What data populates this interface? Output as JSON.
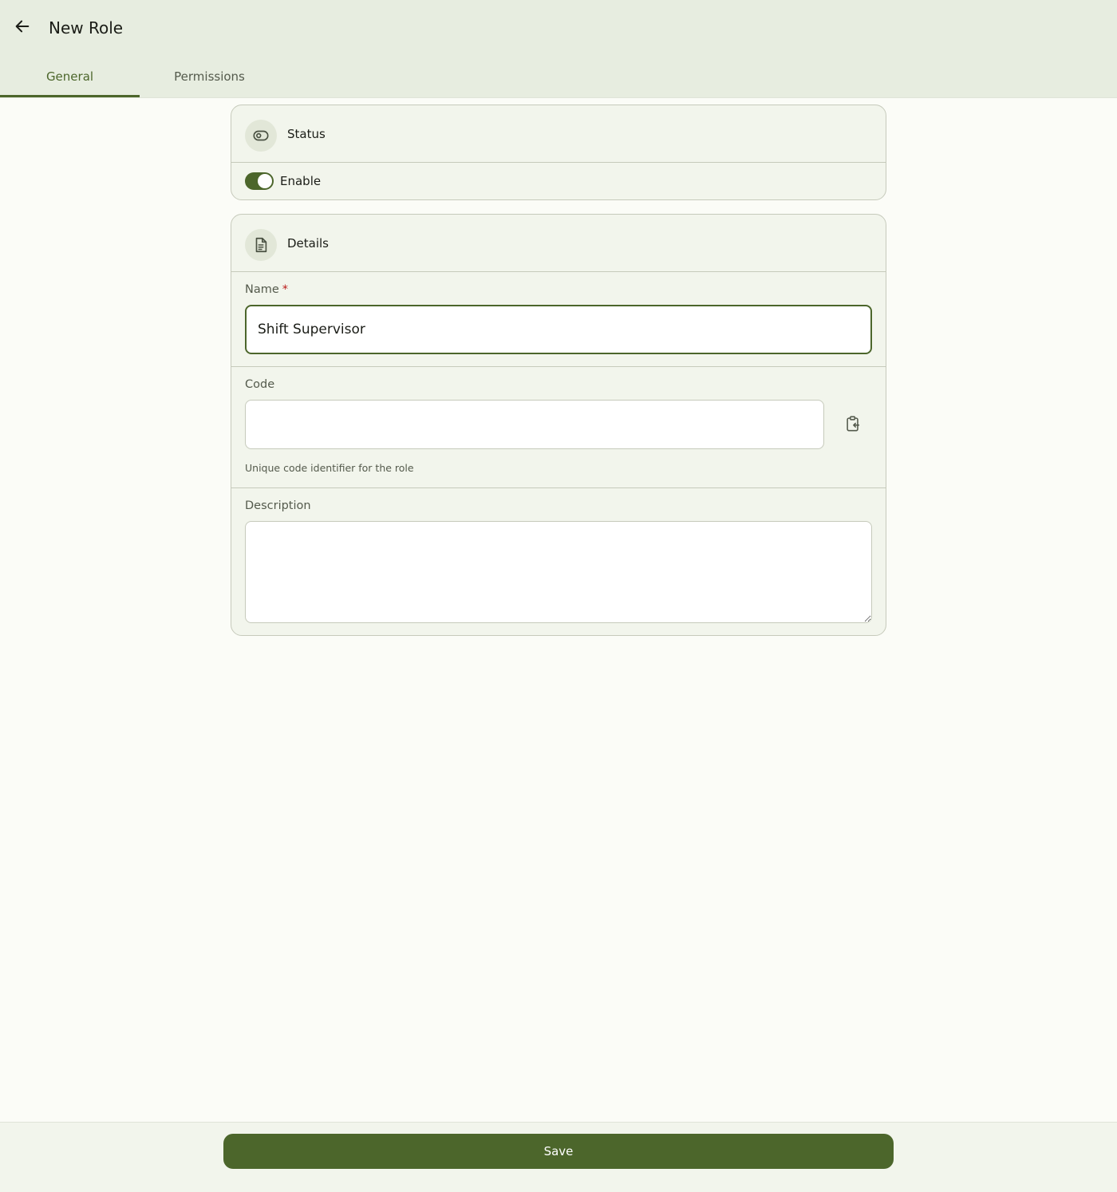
{
  "header": {
    "title": "New Role",
    "back_icon": "arrow-left-icon"
  },
  "tabs": [
    {
      "label": "General",
      "active": true
    },
    {
      "label": "Permissions",
      "active": false
    }
  ],
  "status_card": {
    "title": "Status",
    "icon": "eye-icon",
    "toggle_label": "Enable",
    "toggle_on": true
  },
  "details_card": {
    "title": "Details",
    "icon": "document-icon",
    "name": {
      "label": "Name",
      "required_mark": "*",
      "value": "Shift Supervisor"
    },
    "code": {
      "label": "Code",
      "value": "",
      "helper": "Unique code identifier for the role",
      "action_icon": "clipboard-paste-icon"
    },
    "description": {
      "label": "Description",
      "value": ""
    }
  },
  "footer": {
    "save_label": "Save"
  },
  "colors": {
    "accent": "#4c662b",
    "header_bg": "#e7ede0",
    "card_bg": "#f2f5ec",
    "page_bg": "#fbfcf7",
    "required": "#ba1a1a"
  }
}
